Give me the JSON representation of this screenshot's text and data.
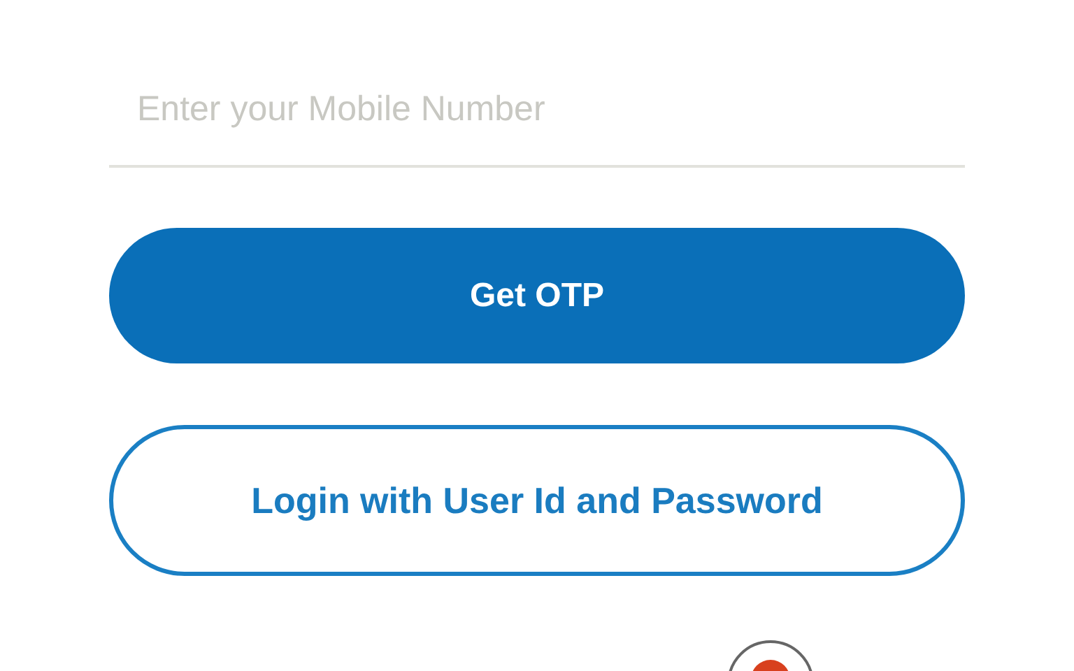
{
  "mobile_field": {
    "placeholder": "Enter your Mobile Number"
  },
  "buttons": [
    {
      "label": "Get OTP",
      "kind": "filled"
    },
    {
      "label": "Login with User Id and Password",
      "kind": "outline"
    }
  ]
}
